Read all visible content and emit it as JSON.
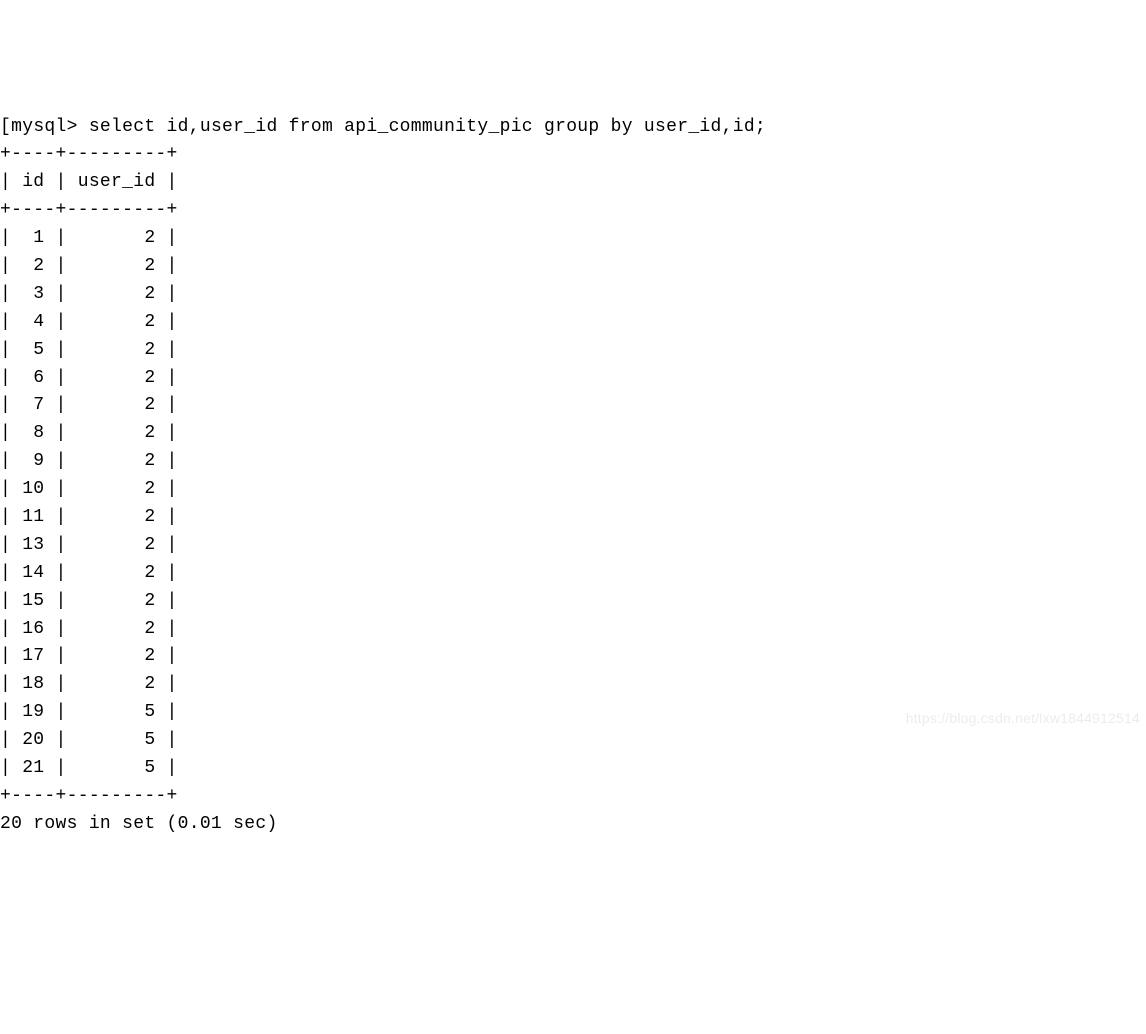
{
  "prompt_bracket": "[",
  "prompt": "mysql> ",
  "query": "select id,user_id from api_community_pic group by user_id,id;",
  "table": {
    "border_top": "+----+---------+",
    "header_line": "| id | user_id |",
    "border_mid": "+----+---------+",
    "rows": [
      "|  1 |       2 |",
      "|  2 |       2 |",
      "|  3 |       2 |",
      "|  4 |       2 |",
      "|  5 |       2 |",
      "|  6 |       2 |",
      "|  7 |       2 |",
      "|  8 |       2 |",
      "|  9 |       2 |",
      "| 10 |       2 |",
      "| 11 |       2 |",
      "| 13 |       2 |",
      "| 14 |       2 |",
      "| 15 |       2 |",
      "| 16 |       2 |",
      "| 17 |       2 |",
      "| 18 |       2 |",
      "| 19 |       5 |",
      "| 20 |       5 |",
      "| 21 |       5 |"
    ],
    "border_bottom": "+----+---------+"
  },
  "result_summary": "20 rows in set (0.01 sec)",
  "watermark": "https://blog.csdn.net/lxw1844912514",
  "chart_data": {
    "type": "table",
    "columns": [
      "id",
      "user_id"
    ],
    "rows": [
      [
        1,
        2
      ],
      [
        2,
        2
      ],
      [
        3,
        2
      ],
      [
        4,
        2
      ],
      [
        5,
        2
      ],
      [
        6,
        2
      ],
      [
        7,
        2
      ],
      [
        8,
        2
      ],
      [
        9,
        2
      ],
      [
        10,
        2
      ],
      [
        11,
        2
      ],
      [
        13,
        2
      ],
      [
        14,
        2
      ],
      [
        15,
        2
      ],
      [
        16,
        2
      ],
      [
        17,
        2
      ],
      [
        18,
        2
      ],
      [
        19,
        5
      ],
      [
        20,
        5
      ],
      [
        21,
        5
      ]
    ],
    "row_count": 20,
    "elapsed_sec": 0.01
  }
}
